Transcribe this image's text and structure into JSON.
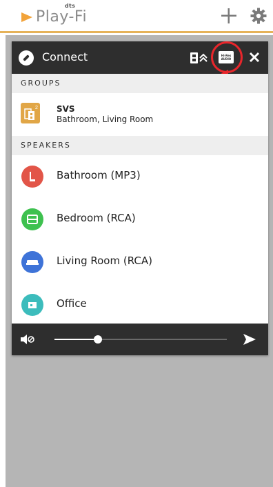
{
  "app": {
    "logo_brand": "dts",
    "logo_name": "Play-Fi",
    "accent_color": "#e6b35a",
    "icons": {
      "add": "plus-icon",
      "settings": "gear-icon"
    }
  },
  "panel": {
    "title": "Connect",
    "icons": {
      "connect": "link-icon",
      "speaker_controls": "speaker-expand-icon",
      "hires": "hi-res-audio-icon",
      "close": "close-icon"
    },
    "hires_badge": {
      "line1": "Hi-Res",
      "line2": "AUDIO"
    },
    "groups_header": "GROUPS",
    "groups": [
      {
        "name": "SVS",
        "members": "Bathroom, Living Room",
        "badge": "2",
        "color": "#e1a646"
      }
    ],
    "speakers_header": "SPEAKERS",
    "speakers": [
      {
        "label": "Bathroom (MP3)",
        "color": "#e25548",
        "icon": "speaker-tower-icon"
      },
      {
        "label": "Bedroom (RCA)",
        "color": "#3ec14f",
        "icon": "speaker-box-icon"
      },
      {
        "label": "Living Room (RCA)",
        "color": "#3e73d8",
        "icon": "sofa-icon"
      },
      {
        "label": "Office",
        "color": "#3cbcbc",
        "icon": "desk-icon"
      }
    ]
  },
  "volume": {
    "level": 0.25,
    "icons": {
      "mute": "mute-icon",
      "send": "send-icon"
    }
  }
}
